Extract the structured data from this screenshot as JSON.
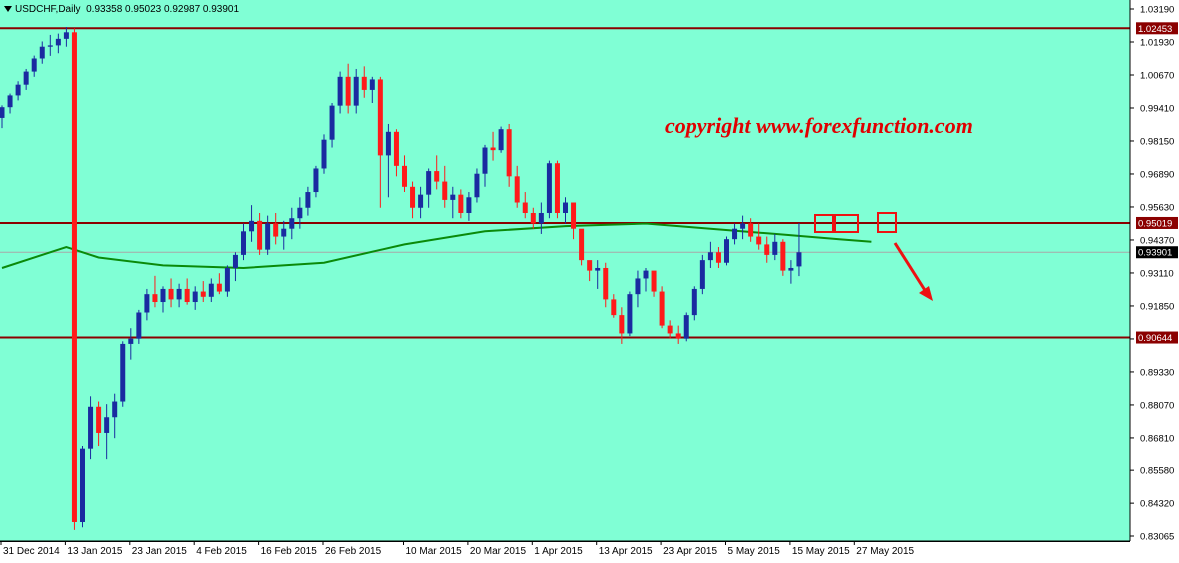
{
  "header": {
    "symbol": "USDCHF,Daily",
    "ohlc": "0.93358 0.95023 0.92987 0.93901"
  },
  "watermark": "copyright  www.forexfunction.com",
  "colors": {
    "background": "#80FFD5",
    "bull": "#1A2BA0",
    "bear": "#FF1A1A",
    "ma": "#0A8A0A",
    "level": "#8B0000",
    "annotation": "#EE1111",
    "watermark": "#E00000"
  },
  "chart_data": {
    "type": "candlestick",
    "symbol": "USDCHF",
    "timeframe": "Daily",
    "ylim": [
      0.83065,
      1.0319
    ],
    "price_ticks": [
      "1.03190",
      "1.01930",
      "1.00670",
      "0.99410",
      "0.98150",
      "0.96890",
      "0.95630",
      "0.94370",
      "0.93110",
      "0.91850",
      "0.90590",
      "0.89330",
      "0.88070",
      "0.86810",
      "0.85580",
      "0.84320",
      "0.83065"
    ],
    "date_labels": [
      {
        "i": 0,
        "label": "31 Dec 2014"
      },
      {
        "i": 8,
        "label": "13 Jan 2015"
      },
      {
        "i": 16,
        "label": "23 Jan 2015"
      },
      {
        "i": 24,
        "label": "4 Feb 2015"
      },
      {
        "i": 32,
        "label": "16 Feb 2015"
      },
      {
        "i": 40,
        "label": "26 Feb 2015"
      },
      {
        "i": 50,
        "label": "10 Mar 2015"
      },
      {
        "i": 58,
        "label": "20 Mar 2015"
      },
      {
        "i": 66,
        "label": "1 Apr 2015"
      },
      {
        "i": 74,
        "label": "13 Apr 2015"
      },
      {
        "i": 82,
        "label": "23 Apr 2015"
      },
      {
        "i": 90,
        "label": "5 May 2015"
      },
      {
        "i": 98,
        "label": "15 May 2015"
      },
      {
        "i": 106,
        "label": "27 May 2015"
      }
    ],
    "horizontal_levels": [
      {
        "price": 1.02453,
        "label": "1.02453"
      },
      {
        "price": 0.95019,
        "label": "0.95019"
      },
      {
        "price": 0.90644,
        "label": "0.90644"
      }
    ],
    "current_price": {
      "price": 0.93901,
      "label": "0.93901"
    },
    "candles": [
      [
        0.9903,
        0.9951,
        0.9864,
        0.9944
      ],
      [
        0.9944,
        0.9996,
        0.992,
        0.9989
      ],
      [
        0.9989,
        1.0043,
        0.997,
        1.003
      ],
      [
        1.003,
        1.009,
        1.001,
        1.008
      ],
      [
        1.008,
        1.0141,
        1.006,
        1.013
      ],
      [
        1.013,
        1.0195,
        1.011,
        1.0175
      ],
      [
        1.0175,
        1.022,
        1.014,
        1.018
      ],
      [
        1.018,
        1.0225,
        1.015,
        1.0205
      ],
      [
        1.0205,
        1.025,
        1.0175,
        1.023
      ],
      [
        1.023,
        1.0245,
        0.833,
        0.836
      ],
      [
        0.836,
        0.865,
        0.834,
        0.864
      ],
      [
        0.864,
        0.884,
        0.86,
        0.88
      ],
      [
        0.88,
        0.882,
        0.865,
        0.87
      ],
      [
        0.87,
        0.881,
        0.86,
        0.876
      ],
      [
        0.876,
        0.885,
        0.868,
        0.882
      ],
      [
        0.882,
        0.905,
        0.88,
        0.904
      ],
      [
        0.904,
        0.91,
        0.898,
        0.906
      ],
      [
        0.906,
        0.917,
        0.904,
        0.916
      ],
      [
        0.916,
        0.925,
        0.913,
        0.923
      ],
      [
        0.923,
        0.93,
        0.918,
        0.92
      ],
      [
        0.92,
        0.926,
        0.916,
        0.925
      ],
      [
        0.925,
        0.929,
        0.918,
        0.921
      ],
      [
        0.921,
        0.927,
        0.918,
        0.925
      ],
      [
        0.925,
        0.929,
        0.919,
        0.92
      ],
      [
        0.92,
        0.926,
        0.917,
        0.924
      ],
      [
        0.924,
        0.928,
        0.92,
        0.922
      ],
      [
        0.922,
        0.929,
        0.92,
        0.927
      ],
      [
        0.927,
        0.931,
        0.923,
        0.924
      ],
      [
        0.924,
        0.934,
        0.922,
        0.933
      ],
      [
        0.933,
        0.939,
        0.928,
        0.938
      ],
      [
        0.938,
        0.95,
        0.936,
        0.947
      ],
      [
        0.947,
        0.957,
        0.943,
        0.951
      ],
      [
        0.951,
        0.954,
        0.938,
        0.94
      ],
      [
        0.94,
        0.953,
        0.938,
        0.95
      ],
      [
        0.95,
        0.954,
        0.942,
        0.945
      ],
      [
        0.945,
        0.951,
        0.94,
        0.948
      ],
      [
        0.948,
        0.956,
        0.944,
        0.952
      ],
      [
        0.952,
        0.96,
        0.948,
        0.956
      ],
      [
        0.956,
        0.964,
        0.953,
        0.962
      ],
      [
        0.962,
        0.972,
        0.96,
        0.971
      ],
      [
        0.971,
        0.984,
        0.969,
        0.982
      ],
      [
        0.982,
        0.996,
        0.979,
        0.995
      ],
      [
        0.995,
        1.008,
        0.992,
        1.006
      ],
      [
        1.006,
        1.011,
        0.992,
        0.995
      ],
      [
        0.995,
        1.009,
        0.992,
        1.006
      ],
      [
        1.006,
        1.01,
        0.998,
        1.001
      ],
      [
        1.001,
        1.006,
        0.996,
        1.005
      ],
      [
        1.005,
        1.006,
        0.956,
        0.976
      ],
      [
        0.976,
        0.988,
        0.96,
        0.985
      ],
      [
        0.985,
        0.986,
        0.968,
        0.972
      ],
      [
        0.972,
        0.976,
        0.962,
        0.964
      ],
      [
        0.964,
        0.966,
        0.952,
        0.956
      ],
      [
        0.956,
        0.964,
        0.952,
        0.961
      ],
      [
        0.961,
        0.971,
        0.956,
        0.97
      ],
      [
        0.97,
        0.976,
        0.963,
        0.966
      ],
      [
        0.966,
        0.972,
        0.956,
        0.959
      ],
      [
        0.959,
        0.964,
        0.952,
        0.961
      ],
      [
        0.961,
        0.963,
        0.952,
        0.954
      ],
      [
        0.954,
        0.962,
        0.951,
        0.96
      ],
      [
        0.96,
        0.971,
        0.958,
        0.969
      ],
      [
        0.969,
        0.98,
        0.964,
        0.979
      ],
      [
        0.979,
        0.985,
        0.974,
        0.978
      ],
      [
        0.978,
        0.987,
        0.977,
        0.986
      ],
      [
        0.986,
        0.988,
        0.964,
        0.968
      ],
      [
        0.968,
        0.972,
        0.956,
        0.958
      ],
      [
        0.958,
        0.962,
        0.952,
        0.954
      ],
      [
        0.954,
        0.956,
        0.948,
        0.95
      ],
      [
        0.95,
        0.958,
        0.946,
        0.954
      ],
      [
        0.954,
        0.974,
        0.952,
        0.973
      ],
      [
        0.973,
        0.974,
        0.952,
        0.954
      ],
      [
        0.954,
        0.96,
        0.95,
        0.958
      ],
      [
        0.958,
        0.956,
        0.944,
        0.948
      ],
      [
        0.948,
        0.944,
        0.934,
        0.936
      ],
      [
        0.936,
        0.934,
        0.928,
        0.932
      ],
      [
        0.932,
        0.936,
        0.925,
        0.933
      ],
      [
        0.933,
        0.935,
        0.918,
        0.921
      ],
      [
        0.921,
        0.923,
        0.914,
        0.915
      ],
      [
        0.915,
        0.918,
        0.904,
        0.908
      ],
      [
        0.908,
        0.924,
        0.907,
        0.923
      ],
      [
        0.923,
        0.932,
        0.918,
        0.929
      ],
      [
        0.929,
        0.933,
        0.924,
        0.932
      ],
      [
        0.932,
        0.931,
        0.922,
        0.924
      ],
      [
        0.924,
        0.926,
        0.91,
        0.911
      ],
      [
        0.911,
        0.913,
        0.906,
        0.908
      ],
      [
        0.908,
        0.911,
        0.904,
        0.906
      ],
      [
        0.906,
        0.916,
        0.905,
        0.915
      ],
      [
        0.915,
        0.926,
        0.913,
        0.925
      ],
      [
        0.925,
        0.938,
        0.923,
        0.936
      ],
      [
        0.936,
        0.943,
        0.933,
        0.939
      ],
      [
        0.939,
        0.941,
        0.933,
        0.935
      ],
      [
        0.935,
        0.945,
        0.934,
        0.944
      ],
      [
        0.944,
        0.95,
        0.942,
        0.948
      ],
      [
        0.948,
        0.953,
        0.944,
        0.95
      ],
      [
        0.95,
        0.952,
        0.943,
        0.945
      ],
      [
        0.945,
        0.95,
        0.94,
        0.942
      ],
      [
        0.942,
        0.945,
        0.935,
        0.938
      ],
      [
        0.938,
        0.946,
        0.936,
        0.943
      ],
      [
        0.943,
        0.944,
        0.93,
        0.932
      ],
      [
        0.932,
        0.936,
        0.927,
        0.933
      ],
      [
        0.9336,
        0.9502,
        0.9299,
        0.939
      ]
    ],
    "moving_average": [
      [
        0,
        0.933
      ],
      [
        8,
        0.941
      ],
      [
        12,
        0.937
      ],
      [
        20,
        0.934
      ],
      [
        30,
        0.933
      ],
      [
        40,
        0.935
      ],
      [
        50,
        0.942
      ],
      [
        60,
        0.947
      ],
      [
        70,
        0.949
      ],
      [
        80,
        0.95
      ],
      [
        88,
        0.948
      ],
      [
        96,
        0.946
      ],
      [
        104,
        0.944
      ],
      [
        108,
        0.943
      ]
    ]
  }
}
